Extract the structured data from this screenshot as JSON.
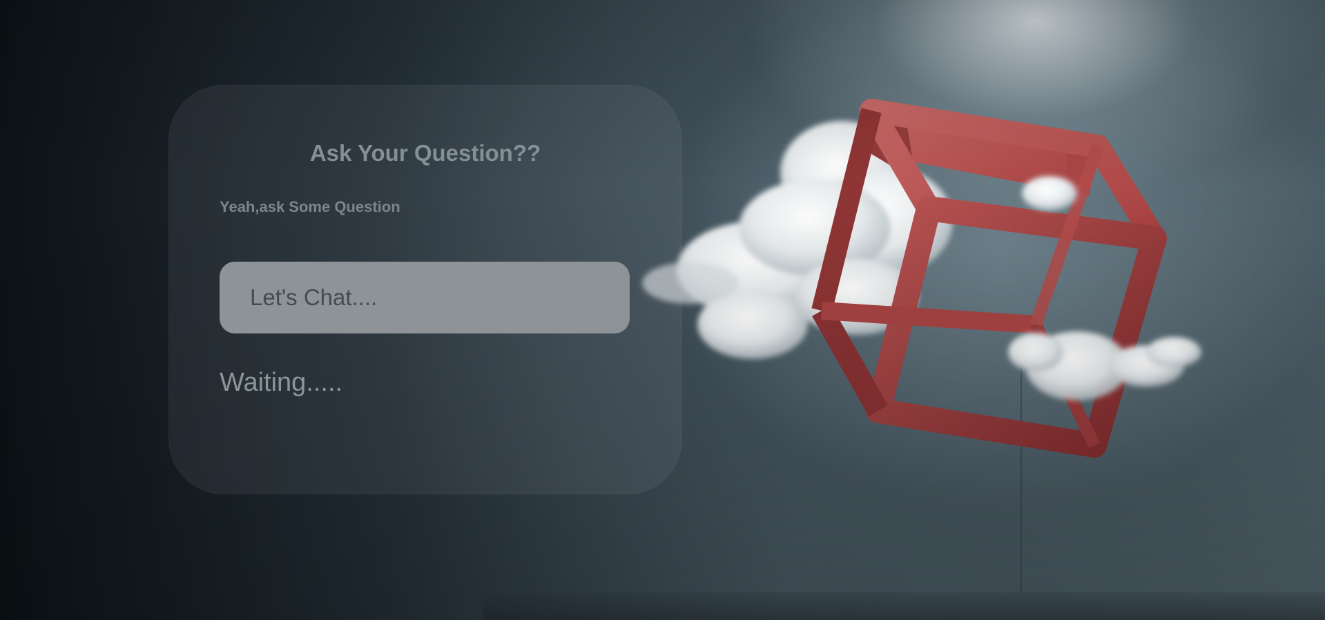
{
  "panel": {
    "title": "Ask Your Question??",
    "subtitle": "Yeah,ask Some Question",
    "chat_input": {
      "placeholder": "Let's Chat....",
      "value": ""
    },
    "status": "Waiting....."
  },
  "colors": {
    "background": "#1c252b",
    "panel_text": "#858f96",
    "input_bg": "#8d9396",
    "cube": "#b5504f",
    "cloud": "#f2f4f5"
  },
  "background_art": {
    "icon": "red-cube-with-clouds-illustration"
  }
}
